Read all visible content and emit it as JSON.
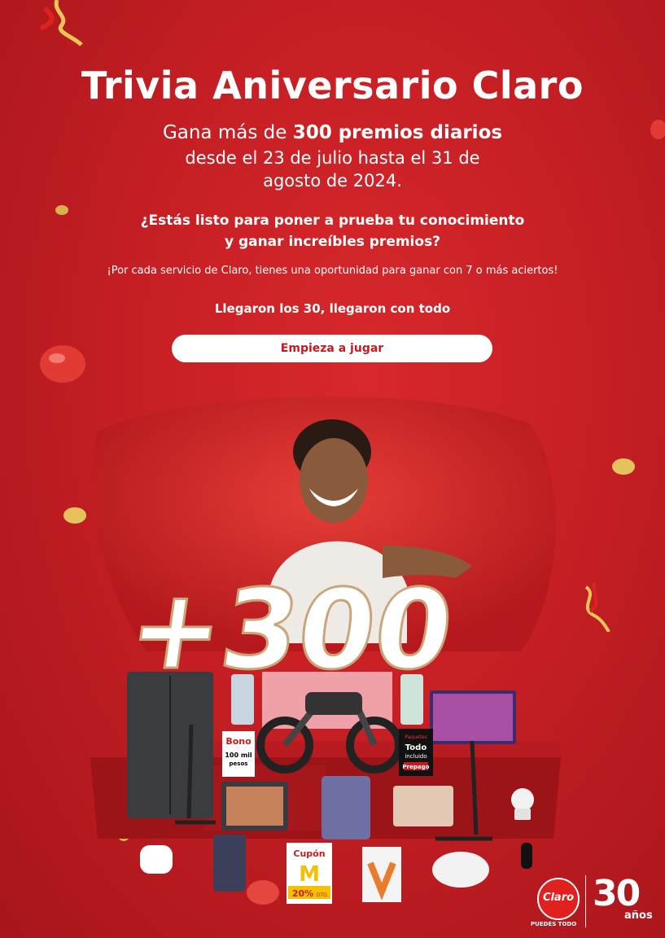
{
  "header": {
    "title": "Trivia Aniversario Claro",
    "subtitle_prefix": "Gana más de ",
    "subtitle_bold": "300 premios diarios",
    "subtitle_line2": "desde el 23 de julio hasta el 31 de",
    "subtitle_line3": "agosto de 2024."
  },
  "question": {
    "line1": "¿Estás listo para poner a prueba tu conocimiento",
    "line2": "y ganar increíbles premios?"
  },
  "note": "¡Por cada servicio de Claro, tienes una oportunidad para ganar con 7 o más aciertos!",
  "slogan": "Llegaron los 30, llegaron con todo",
  "cta_label": "Empieza a jugar",
  "hero": {
    "big_number": "+300",
    "bono_label": "Bono",
    "bono_amount": "100 mil",
    "bono_unit": "pesos",
    "pack_top": "Paquetes",
    "pack_main": "Todo",
    "pack_sub": "incluido",
    "pack_tag": "Prepago",
    "cupon_label": "Cupón",
    "cupon_discount": "20%",
    "cupon_suffix": "OTO."
  },
  "brand": {
    "logo_text": "Claro",
    "tagline": "PUEDES TODO",
    "anniversary_number": "30",
    "anniversary_word": "años",
    "accent": "#c41b21"
  }
}
